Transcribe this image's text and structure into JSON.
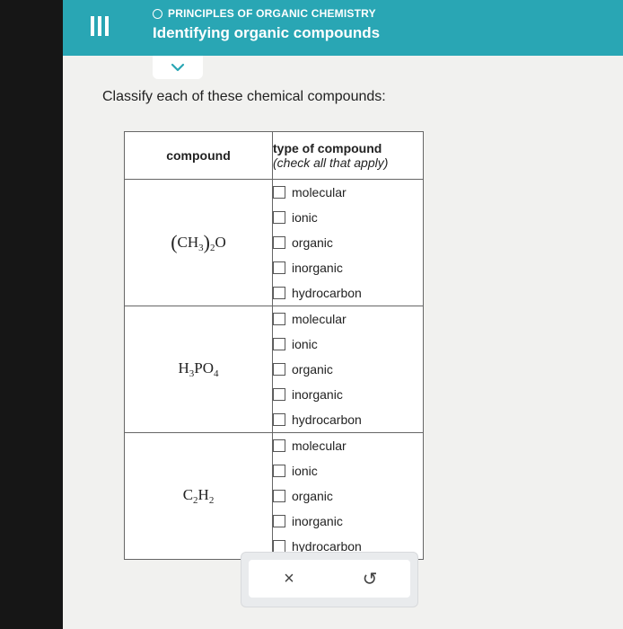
{
  "header": {
    "breadcrumb": "PRINCIPLES OF ORGANIC CHEMISTRY",
    "title": "Identifying organic compounds"
  },
  "prompt": "Classify each of these chemical compounds:",
  "table": {
    "col_compound": "compound",
    "col_type": "type of compound",
    "col_type_hint": "(check all that apply)",
    "options": [
      "molecular",
      "ionic",
      "organic",
      "inorganic",
      "hydrocarbon"
    ],
    "compounds": [
      {
        "name": "(CH3)2O",
        "checked": [
          false,
          false,
          false,
          false,
          false
        ]
      },
      {
        "name": "H3PO4",
        "checked": [
          false,
          false,
          false,
          false,
          false
        ]
      },
      {
        "name": "C2H2",
        "checked": [
          false,
          false,
          false,
          false,
          false
        ]
      }
    ]
  },
  "actions": {
    "clear_symbol": "×",
    "undo_symbol": "↺"
  },
  "colors": {
    "header": "#29a6b4",
    "background": "#f1f1ef"
  }
}
